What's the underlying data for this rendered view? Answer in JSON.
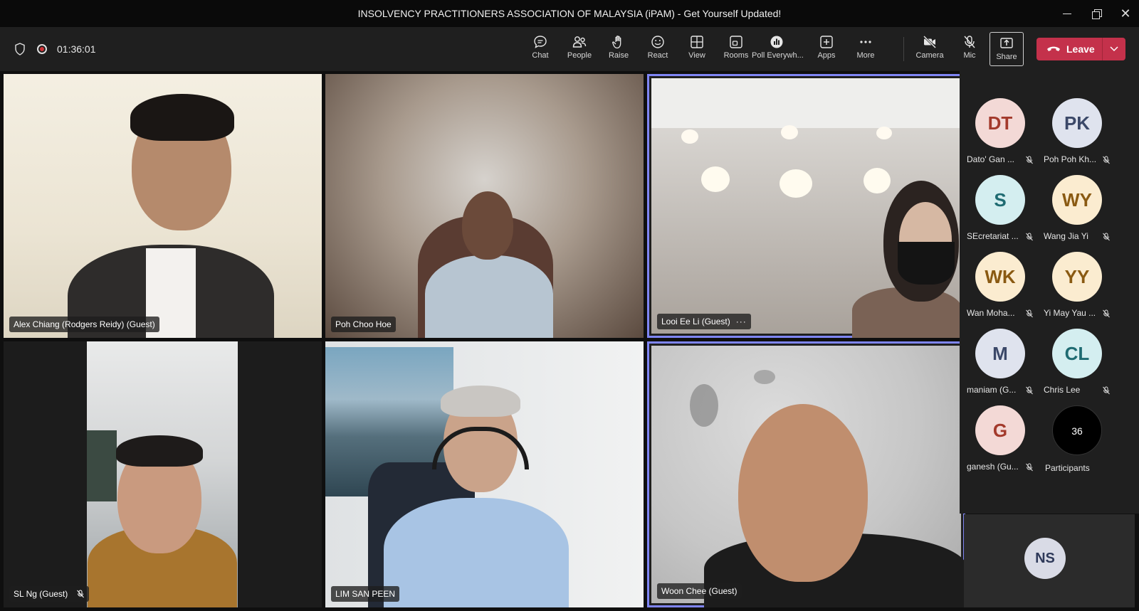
{
  "window": {
    "title": "INSOLVENCY PRACTITIONERS ASSOCIATION OF MALAYSIA (iPAM) - Get Yourself Updated!"
  },
  "meeting": {
    "elapsed": "01:36:01"
  },
  "toolbar": {
    "chat": "Chat",
    "people": "People",
    "raise": "Raise",
    "react": "React",
    "view": "View",
    "rooms": "Rooms",
    "poll": "Poll Everywh...",
    "apps": "Apps",
    "more": "More",
    "camera": "Camera",
    "mic": "Mic",
    "share": "Share",
    "leave": "Leave"
  },
  "tiles": [
    {
      "name": "Alex Chiang (Rodgers Reidy) (Guest)"
    },
    {
      "name": "Poh Choo Hoe"
    },
    {
      "name": "Looi Ee Li (Guest)"
    },
    {
      "name": "SL Ng (Guest)"
    },
    {
      "name": "LIM SAN PEEN"
    },
    {
      "name": "Woon Chee (Guest)"
    }
  ],
  "roster": [
    {
      "initials": "DT",
      "name": "Dato' Gan ...",
      "bg": "#f3d9d6",
      "fg": "#a33a2c"
    },
    {
      "initials": "PK",
      "name": "Poh Poh Kh...",
      "bg": "#dfe3ee",
      "fg": "#3b4868"
    },
    {
      "initials": "S",
      "name": "SEcretariat ...",
      "bg": "#d4eef0",
      "fg": "#1f6b72"
    },
    {
      "initials": "WY",
      "name": "Wang Jia Yi",
      "bg": "#fbecd0",
      "fg": "#8a5a12"
    },
    {
      "initials": "WK",
      "name": "Wan Moha...",
      "bg": "#fbecd0",
      "fg": "#8a5a12"
    },
    {
      "initials": "YY",
      "name": "Yi May Yau ...",
      "bg": "#fbecd0",
      "fg": "#8a5a12"
    },
    {
      "initials": "M",
      "name": "maniam (G...",
      "bg": "#dfe3ee",
      "fg": "#3b4868"
    },
    {
      "initials": "CL",
      "name": "Chris Lee",
      "bg": "#d4eef0",
      "fg": "#1f6b72"
    },
    {
      "initials": "G",
      "name": "ganesh (Gu...",
      "bg": "#f3d9d6",
      "fg": "#a33a2c"
    }
  ],
  "participants": {
    "count": "36",
    "label": "Participants"
  },
  "self": {
    "initials": "NS"
  }
}
